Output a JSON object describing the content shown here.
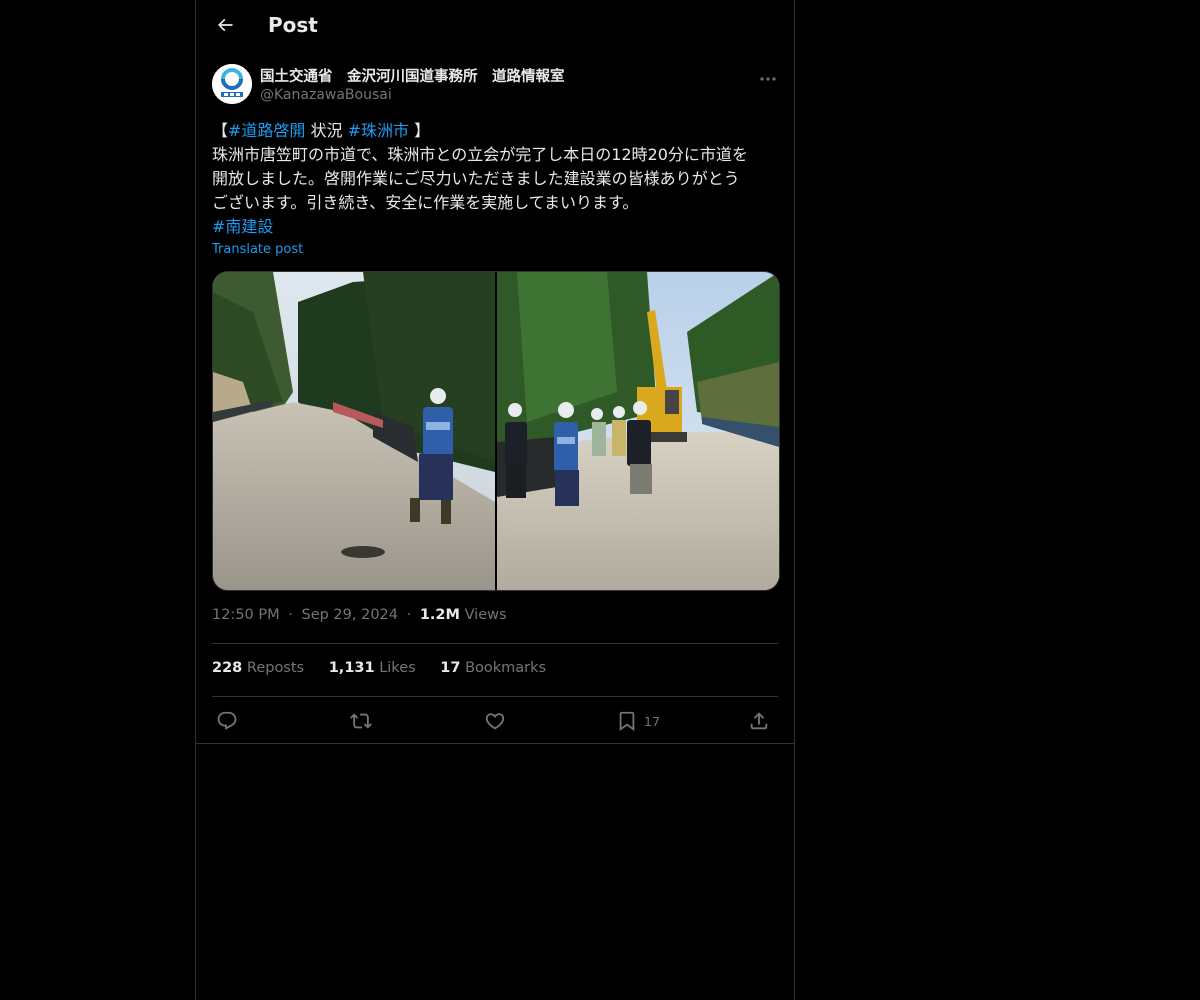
{
  "header": {
    "title": "Post",
    "back_icon": "arrow-left-icon"
  },
  "author": {
    "display_name": "国土交通省　金沢河川国道事務所　道路情報室",
    "handle": "@KanazawaBousai",
    "avatar_icon": "mlit-logo-avatar"
  },
  "post": {
    "line1": {
      "open": "【",
      "tag1": "#道路啓開",
      "middle": " 状況 ",
      "tag2": "#珠洲市",
      "close": " 】"
    },
    "line2": "珠洲市唐笠町の市道で、珠洲市との立会が完了し本日の12時20分に市道を",
    "line3": "開放しました。啓開作業にご尽力いただきました建設業の皆様ありがとう",
    "line4": "ございます。引き続き、安全に作業を実施してまいります。",
    "tag3": "#南建設",
    "translate": "Translate post"
  },
  "meta": {
    "time": "12:50 PM",
    "sep": "·",
    "date": "Sep 29, 2024",
    "views_count": "1.2M",
    "views_label": "Views"
  },
  "stats": {
    "reposts_count": "228",
    "reposts_label": "Reposts",
    "likes_count": "1,131",
    "likes_label": "Likes",
    "bookmarks_count": "17",
    "bookmarks_label": "Bookmarks"
  },
  "actions": {
    "reply_icon": "reply-icon",
    "repost_icon": "repost-icon",
    "like_icon": "heart-icon",
    "bookmark_icon": "bookmark-icon",
    "bookmark_count": "17",
    "share_icon": "share-icon"
  },
  "colors": {
    "background": "#000000",
    "text": "#e7e9ea",
    "muted": "#71767b",
    "accent": "#1d9bf0",
    "border": "#2f3336"
  }
}
